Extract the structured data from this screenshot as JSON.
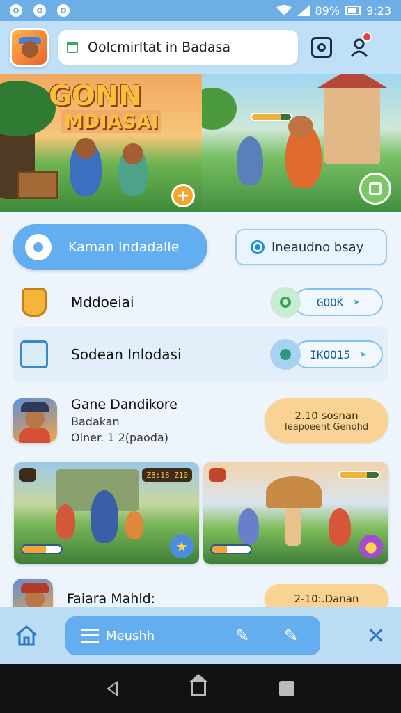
{
  "status_bar": {
    "battery": "89%",
    "time": "9:23",
    "icons": [
      "notification-icon",
      "chat-icon",
      "cloud-icon",
      "wifi-icon",
      "signal-icon",
      "battery-icon"
    ]
  },
  "app_bar": {
    "search_value": "Oolcmirltat in Badasa",
    "icons": [
      "app-logo-icon",
      "home-icon",
      "camera-icon",
      "user-icon"
    ]
  },
  "hero": {
    "left_title": "GONN",
    "left_subtitle": "MDIASAI",
    "health_fraction": 0.75
  },
  "actions": {
    "primary_label": "Kaman Indadalle",
    "secondary_label": "Ineaudno bsay"
  },
  "list": {
    "row1": {
      "label": "Mddoeiai",
      "pill": "GOOK"
    },
    "row2": {
      "label": "Sodean Inlodasi",
      "pill": "IKOO15"
    }
  },
  "game": {
    "title": "Gane Dandikore",
    "subtitle": "Badakan",
    "meta": "Olner. 1 2(paoda)",
    "offer_line1": "2.10 sosnan",
    "offer_line2": "Ieapoeent Genohd"
  },
  "cards": {
    "card_a_tag": "Z8:18 Z10",
    "card_a_progress": 0.6,
    "card_b_progress": 0.4
  },
  "row4": {
    "title": "Faiara Mahld:",
    "offer": "2-10:.Danan"
  },
  "bottom_nav": {
    "pill_label": "Meushh"
  },
  "colors": {
    "accent": "#62aef0",
    "app_bar": "#bfe0f6",
    "offer": "#fad394",
    "system_nav": "#121212"
  }
}
